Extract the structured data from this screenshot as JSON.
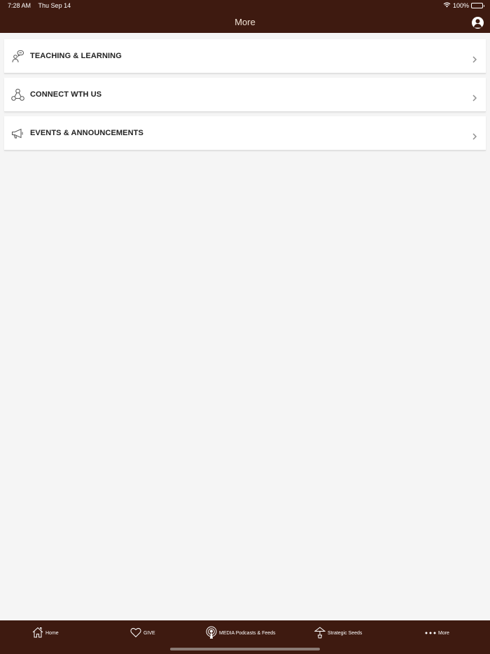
{
  "status_bar": {
    "time": "7:28 AM",
    "date": "Thu Sep 14",
    "battery": "100%",
    "icons": [
      "wifi-icon",
      "battery-icon"
    ]
  },
  "nav": {
    "title": "More",
    "profile_icon": "user-profile-icon"
  },
  "menu": {
    "items": [
      {
        "label": "TEACHING & LEARNING",
        "icon": "teaching-icon"
      },
      {
        "label": "CONNECT WTH US",
        "icon": "network-icon"
      },
      {
        "label": "EVENTS & ANNOUNCEMENTS",
        "icon": "megaphone-icon"
      }
    ]
  },
  "tabs": [
    {
      "label": "Home",
      "icon": "home-icon"
    },
    {
      "label": "GIVE",
      "icon": "heart-icon"
    },
    {
      "label": "MEDIA Podcasts & Feeds",
      "icon": "podcast-icon"
    },
    {
      "label": "Strategic Seeds",
      "icon": "seedling-icon"
    },
    {
      "label": "More",
      "icon": "more-dots-icon"
    }
  ],
  "colors": {
    "bar_background": "#3e1a10",
    "page_background": "#f5f5f5",
    "nav_title": "#f1e3d6"
  }
}
